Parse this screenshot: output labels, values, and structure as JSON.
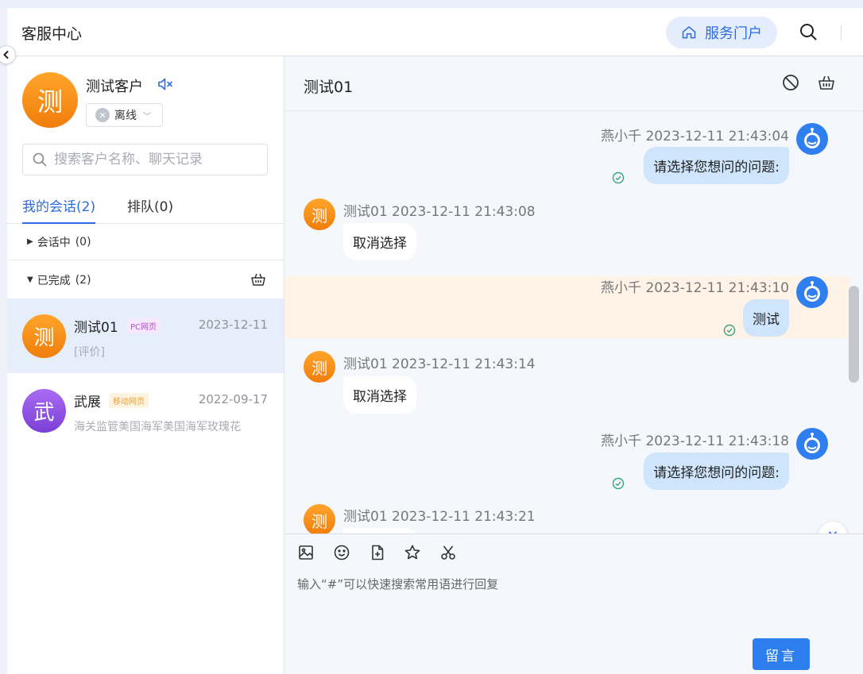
{
  "header": {
    "title": "客服中心",
    "portal_label": "服务门户"
  },
  "customer": {
    "avatar_char": "测",
    "name": "测试客户",
    "status": "离线"
  },
  "search": {
    "placeholder": "搜索客户名称、聊天记录"
  },
  "tabs": [
    {
      "label": "我的会话(2)",
      "active": true
    },
    {
      "label": "排队(0)",
      "active": false
    }
  ],
  "groups": [
    {
      "label": "会话中",
      "count": "(0)",
      "expanded": false
    },
    {
      "label": "已完成",
      "count": "(2)",
      "expanded": true
    }
  ],
  "conversations": [
    {
      "avatar_char": "测",
      "name": "测试01",
      "tag": "PC网页",
      "date": "2023-12-11",
      "preview": "[评价]",
      "active": true,
      "avatar_color": "#f28c12",
      "tag_color": "#b54ccf"
    },
    {
      "avatar_char": "武",
      "name": "武展",
      "tag": "移动网页",
      "date": "2022-09-17",
      "preview": "海关监管美国海军美国海军玫瑰花",
      "active": false,
      "avatar_color": "#8e4fe0",
      "tag_color": "#e6a23c"
    }
  ],
  "chat": {
    "title": "测试01",
    "messages": [
      {
        "direction": "out",
        "sender": "燕小千",
        "time": "2023-12-11 21:43:04",
        "text": "请选择您想问的问题:",
        "read": true
      },
      {
        "direction": "in",
        "sender": "测试01",
        "time": "2023-12-11 21:43:08",
        "text": "取消选择",
        "avatar_char": "测"
      },
      {
        "direction": "out",
        "sender": "燕小千",
        "time": "2023-12-11 21:43:10",
        "text": "测试",
        "read": true,
        "highlighted": true
      },
      {
        "direction": "in",
        "sender": "测试01",
        "time": "2023-12-11 21:43:14",
        "text": "取消选择",
        "avatar_char": "测"
      },
      {
        "direction": "out",
        "sender": "燕小千",
        "time": "2023-12-11 21:43:18",
        "text": "请选择您想问的问题:",
        "read": true
      },
      {
        "direction": "in",
        "sender": "测试01",
        "time": "2023-12-11 21:43:21",
        "text": "",
        "avatar_char": "测"
      }
    ]
  },
  "composer": {
    "placeholder": "输入“#”可以快速搜索常用语进行回复",
    "send_label": "留言",
    "tools": [
      "image-icon",
      "emoji-icon",
      "file-add-icon",
      "star-icon",
      "scissors-icon"
    ]
  },
  "colors": {
    "accent": "#2d6be4",
    "out_bubble": "#cfe5fb",
    "highlight_row": "#fff2e6"
  }
}
